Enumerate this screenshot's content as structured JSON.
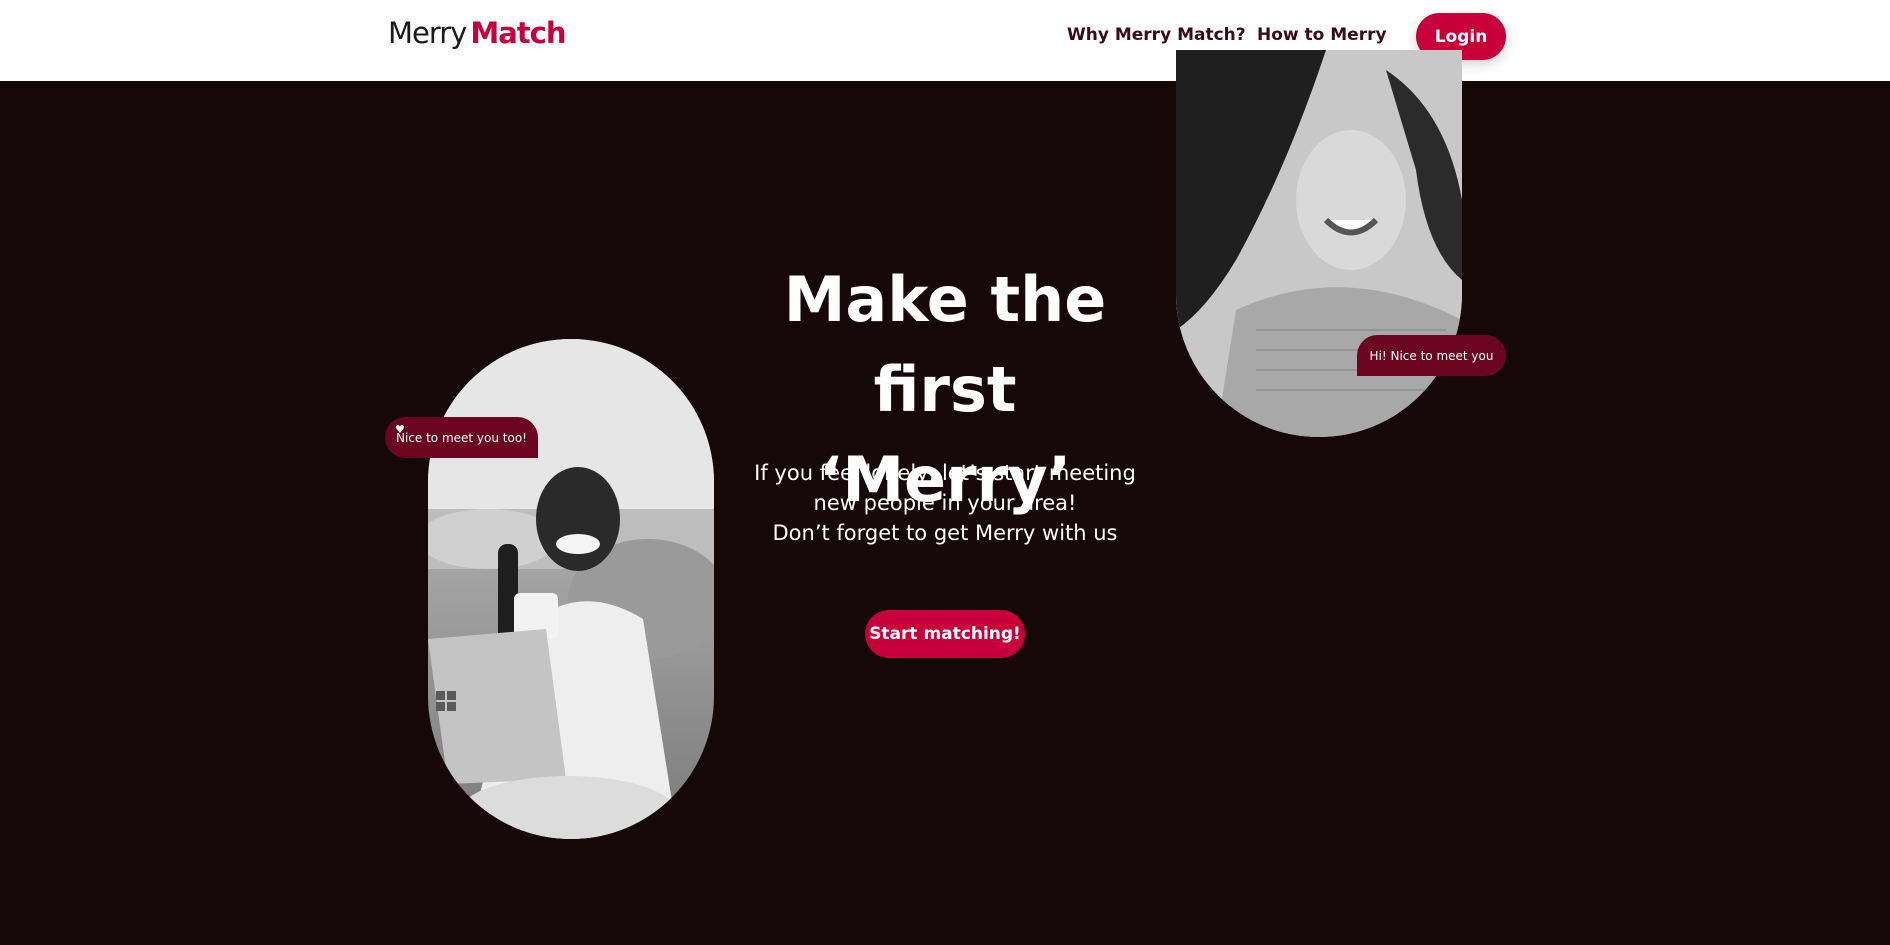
{
  "header": {
    "logo_part1": "Merry",
    "logo_part2": "Match",
    "nav": {
      "why": "Why Merry Match?",
      "how": "How to Merry"
    },
    "login_label": "Login"
  },
  "hero": {
    "title_line1": "Make the",
    "title_line2": "first ‘Merry’",
    "sub_line1": "If you feel lonely, let’s start meeting",
    "sub_line2": "new people in your area!",
    "sub_line3": "Don’t forget to get Merry with us",
    "cta_label": "Start matching!"
  },
  "bubbles": {
    "left": "Nice to meet you too!",
    "right": "Hi! Nice to meet you"
  },
  "colors": {
    "brand": "#c70039",
    "background": "#160808",
    "bubble": "#6b0520"
  }
}
